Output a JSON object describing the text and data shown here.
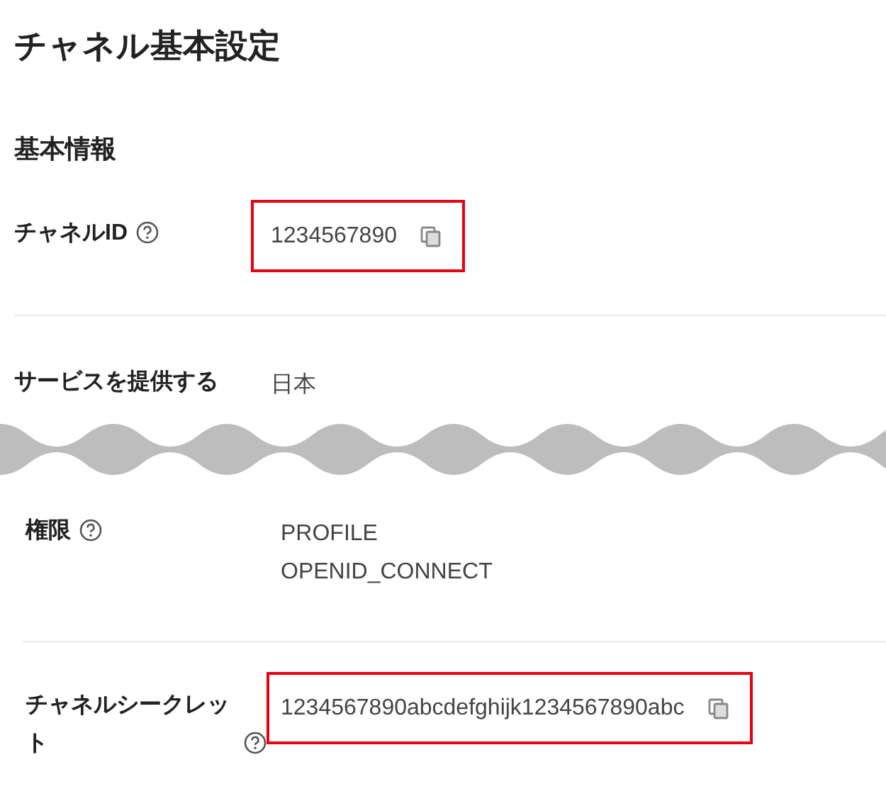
{
  "title": "チャネル基本設定",
  "section": {
    "heading": "基本情報"
  },
  "rows": [
    {
      "label": "チャネルID",
      "help": true,
      "values": [
        "1234567890"
      ],
      "copyable": true,
      "highlighted": true
    },
    {
      "label": "サービスを提供する",
      "help": false,
      "values": [
        "日本"
      ],
      "copyable": false,
      "highlighted": false
    }
  ],
  "after_cut_rows": [
    {
      "label": "権限",
      "help": true,
      "values": [
        "PROFILE",
        "OPENID_CONNECT"
      ],
      "copyable": false,
      "highlighted": false
    },
    {
      "label": "チャネルシークレット",
      "help": true,
      "values": [
        "1234567890abcdefghijk1234567890abc"
      ],
      "copyable": true,
      "highlighted": true
    }
  ]
}
